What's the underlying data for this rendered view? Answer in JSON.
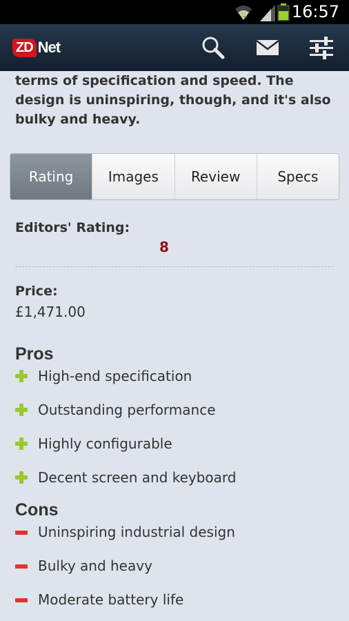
{
  "status": {
    "time": "16:57",
    "wifi_icon": "wifi-icon",
    "signal_icon": "cell-signal-icon",
    "battery_icon": "battery-icon"
  },
  "appbar": {
    "logo_zd": "ZD",
    "logo_net": "Net",
    "actions": [
      {
        "name": "search-icon"
      },
      {
        "name": "mail-icon"
      },
      {
        "name": "settings-sliders-icon"
      }
    ]
  },
  "intro_text": "terms of specification and speed. The design is uninspiring, though, and it's also bulky and heavy.",
  "tabs": [
    {
      "label": "Rating",
      "active": true
    },
    {
      "label": "Images"
    },
    {
      "label": "Review"
    },
    {
      "label": "Specs"
    }
  ],
  "rating": {
    "label": "Editors' Rating:",
    "value": "8"
  },
  "price": {
    "label": "Price:",
    "value": "£1,471.00"
  },
  "pros": {
    "heading": "Pros",
    "items": [
      "High-end specification",
      "Outstanding performance",
      "Highly configurable",
      "Decent screen and keyboard"
    ]
  },
  "cons": {
    "heading": "Cons",
    "items": [
      "Uninspiring industrial design",
      "Bulky and heavy",
      "Moderate battery life"
    ]
  },
  "colors": {
    "accent_red": "#9a0c0c",
    "pro_green": "#9bc72f",
    "con_red": "#e0332c",
    "appbar": "#1c2b3c"
  }
}
